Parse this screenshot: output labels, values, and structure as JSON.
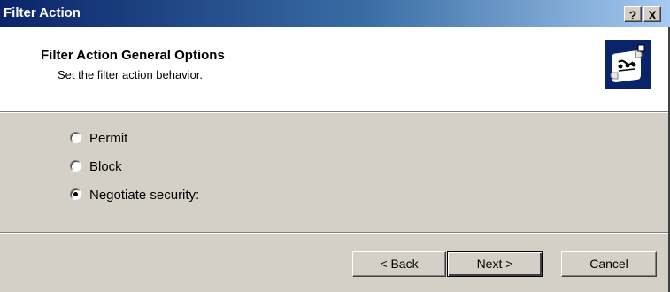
{
  "window": {
    "title": "Filter Action",
    "help_label": "?",
    "close_label": "X"
  },
  "header": {
    "title": "Filter Action General Options",
    "subtitle": "Set the filter action behavior.",
    "icon": "scroll-wizard-icon"
  },
  "options": [
    {
      "label": "Permit",
      "selected": false
    },
    {
      "label": "Block",
      "selected": false
    },
    {
      "label": "Negotiate security:",
      "selected": true
    }
  ],
  "buttons": {
    "back_label": "< Back",
    "next_label": "Next >",
    "cancel_label": "Cancel"
  },
  "colors": {
    "title_bar_start": "#0a246a",
    "title_bar_end": "#a6caf0",
    "dialog_face": "#d4d0c8",
    "header_background": "#ffffff"
  }
}
